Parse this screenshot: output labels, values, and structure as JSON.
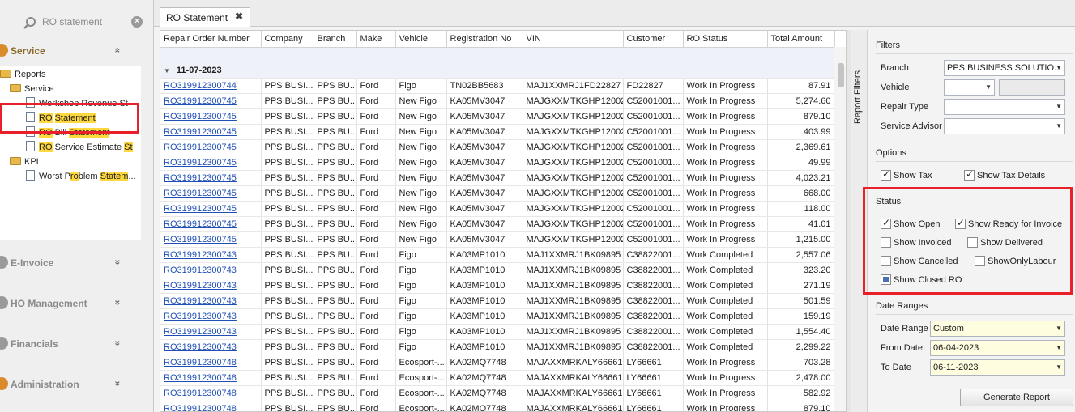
{
  "search": {
    "text": "RO statement"
  },
  "nav": {
    "service_label": "Service",
    "einvoice_label": "E-Invoice",
    "hom_label": "HO Management",
    "financials_label": "Financials",
    "admin_label": "Administration",
    "chev_up": "«",
    "chev_down": "»"
  },
  "tree": {
    "reports": "Reports",
    "service": "Service",
    "workshop": "Workshop Revenue St",
    "ro_statement_a": "RO",
    "ro_statement_b": "Statement",
    "ro_bill_a": "RO",
    "ro_bill_b": "Bill",
    "ro_bill_c": "Statement",
    "ro_est_a": "RO",
    "ro_est_b": "Service Estimate",
    "ro_est_c": "St",
    "kpi": "KPI",
    "worst_a": "Worst P",
    "worst_b": "ro",
    "worst_c": "blem",
    "worst_d": "Statem"
  },
  "tab": {
    "label": "RO Statement",
    "close": "✖"
  },
  "grid": {
    "columns": [
      "Repair Order Number",
      "Company",
      "Branch",
      "Make",
      "Vehicle",
      "Registration No",
      "VIN",
      "Customer",
      "RO Status",
      "Total Amount"
    ],
    "group_label": "11-07-2023",
    "rows": [
      [
        "RO319912300744",
        "PPS BUSI...",
        "PPS BU...",
        "Ford",
        "Figo",
        "TN02BB5683",
        "MAJ1XXMRJ1FD22827",
        "FD22827",
        "Work In Progress",
        "87.91"
      ],
      [
        "RO319912300745",
        "PPS BUSI...",
        "PPS BU...",
        "Ford",
        "New Figo",
        "KA05MV3047",
        "MAJGXXMTKGHP12002",
        "C52001001...",
        "Work In Progress",
        "5,274.60"
      ],
      [
        "RO319912300745",
        "PPS BUSI...",
        "PPS BU...",
        "Ford",
        "New Figo",
        "KA05MV3047",
        "MAJGXXMTKGHP12002",
        "C52001001...",
        "Work In Progress",
        "879.10"
      ],
      [
        "RO319912300745",
        "PPS BUSI...",
        "PPS BU...",
        "Ford",
        "New Figo",
        "KA05MV3047",
        "MAJGXXMTKGHP12002",
        "C52001001...",
        "Work In Progress",
        "403.99"
      ],
      [
        "RO319912300745",
        "PPS BUSI...",
        "PPS BU...",
        "Ford",
        "New Figo",
        "KA05MV3047",
        "MAJGXXMTKGHP12002",
        "C52001001...",
        "Work In Progress",
        "2,369.61"
      ],
      [
        "RO319912300745",
        "PPS BUSI...",
        "PPS BU...",
        "Ford",
        "New Figo",
        "KA05MV3047",
        "MAJGXXMTKGHP12002",
        "C52001001...",
        "Work In Progress",
        "49.99"
      ],
      [
        "RO319912300745",
        "PPS BUSI...",
        "PPS BU...",
        "Ford",
        "New Figo",
        "KA05MV3047",
        "MAJGXXMTKGHP12002",
        "C52001001...",
        "Work In Progress",
        "4,023.21"
      ],
      [
        "RO319912300745",
        "PPS BUSI...",
        "PPS BU...",
        "Ford",
        "New Figo",
        "KA05MV3047",
        "MAJGXXMTKGHP12002",
        "C52001001...",
        "Work In Progress",
        "668.00"
      ],
      [
        "RO319912300745",
        "PPS BUSI...",
        "PPS BU...",
        "Ford",
        "New Figo",
        "KA05MV3047",
        "MAJGXXMTKGHP12002",
        "C52001001...",
        "Work In Progress",
        "118.00"
      ],
      [
        "RO319912300745",
        "PPS BUSI...",
        "PPS BU...",
        "Ford",
        "New Figo",
        "KA05MV3047",
        "MAJGXXMTKGHP12002",
        "C52001001...",
        "Work In Progress",
        "41.01"
      ],
      [
        "RO319912300745",
        "PPS BUSI...",
        "PPS BU...",
        "Ford",
        "New Figo",
        "KA05MV3047",
        "MAJGXXMTKGHP12002",
        "C52001001...",
        "Work In Progress",
        "1,215.00"
      ],
      [
        "RO319912300743",
        "PPS BUSI...",
        "PPS BU...",
        "Ford",
        "Figo",
        "KA03MP1010",
        "MAJ1XXMRJ1BK09895",
        "C38822001...",
        "Work Completed",
        "2,557.06"
      ],
      [
        "RO319912300743",
        "PPS BUSI...",
        "PPS BU...",
        "Ford",
        "Figo",
        "KA03MP1010",
        "MAJ1XXMRJ1BK09895",
        "C38822001...",
        "Work Completed",
        "323.20"
      ],
      [
        "RO319912300743",
        "PPS BUSI...",
        "PPS BU...",
        "Ford",
        "Figo",
        "KA03MP1010",
        "MAJ1XXMRJ1BK09895",
        "C38822001...",
        "Work Completed",
        "271.19"
      ],
      [
        "RO319912300743",
        "PPS BUSI...",
        "PPS BU...",
        "Ford",
        "Figo",
        "KA03MP1010",
        "MAJ1XXMRJ1BK09895",
        "C38822001...",
        "Work Completed",
        "501.59"
      ],
      [
        "RO319912300743",
        "PPS BUSI...",
        "PPS BU...",
        "Ford",
        "Figo",
        "KA03MP1010",
        "MAJ1XXMRJ1BK09895",
        "C38822001...",
        "Work Completed",
        "159.19"
      ],
      [
        "RO319912300743",
        "PPS BUSI...",
        "PPS BU...",
        "Ford",
        "Figo",
        "KA03MP1010",
        "MAJ1XXMRJ1BK09895",
        "C38822001...",
        "Work Completed",
        "1,554.40"
      ],
      [
        "RO319912300743",
        "PPS BUSI...",
        "PPS BU...",
        "Ford",
        "Figo",
        "KA03MP1010",
        "MAJ1XXMRJ1BK09895",
        "C38822001...",
        "Work Completed",
        "2,299.22"
      ],
      [
        "RO319912300748",
        "PPS BUSI...",
        "PPS BU...",
        "Ford",
        "Ecosport-...",
        "KA02MQ7748",
        "MAJAXXMRKALY66661",
        "LY66661",
        "Work In Progress",
        "703.28"
      ],
      [
        "RO319912300748",
        "PPS BUSI...",
        "PPS BU...",
        "Ford",
        "Ecosport-...",
        "KA02MQ7748",
        "MAJAXXMRKALY66661",
        "LY66661",
        "Work In Progress",
        "2,478.00"
      ],
      [
        "RO319912300748",
        "PPS BUSI...",
        "PPS BU...",
        "Ford",
        "Ecosport-...",
        "KA02MQ7748",
        "MAJAXXMRKALY66661",
        "LY66661",
        "Work In Progress",
        "582.92"
      ],
      [
        "RO319912300748",
        "PPS BUSI...",
        "PPS BU...",
        "Ford",
        "Ecosport-...",
        "KA02MQ7748",
        "MAJAXXMRKALY66661",
        "LY66661",
        "Work In Progress",
        "879.10"
      ]
    ]
  },
  "panel": {
    "vertical_tab": "Report Filters",
    "filters_title": "Filters",
    "branch_label": "Branch",
    "branch_value": "PPS BUSINESS SOLUTIO...",
    "vehicle_label": "Vehicle",
    "vehicle_value": "",
    "repair_type_label": "Repair Type",
    "repair_type_value": "",
    "service_advisor_label": "Service Advisor",
    "service_advisor_value": "",
    "options_title": "Options",
    "show_tax": "Show Tax",
    "show_tax_details": "Show Tax Details",
    "status_title": "Status",
    "show_open": "Show Open",
    "show_ready": "Show Ready for Invoice",
    "show_invoiced": "Show Invoiced",
    "show_delivered": "Show Delivered",
    "show_cancelled": "Show Cancelled",
    "show_only_labour": "ShowOnlyLabour",
    "show_closed": "Show Closed RO",
    "date_ranges_title": "Date Ranges",
    "date_range_label": "Date Range",
    "date_range_value": "Custom",
    "from_label": "From Date",
    "from_value": "06-04-2023",
    "to_label": "To Date",
    "to_value": "06-11-2023",
    "generate_button": "Generate Report"
  },
  "colors": {
    "highlight_box": "#e8202a",
    "link": "#1f4fb5",
    "search_highlight": "#ffd83d"
  }
}
